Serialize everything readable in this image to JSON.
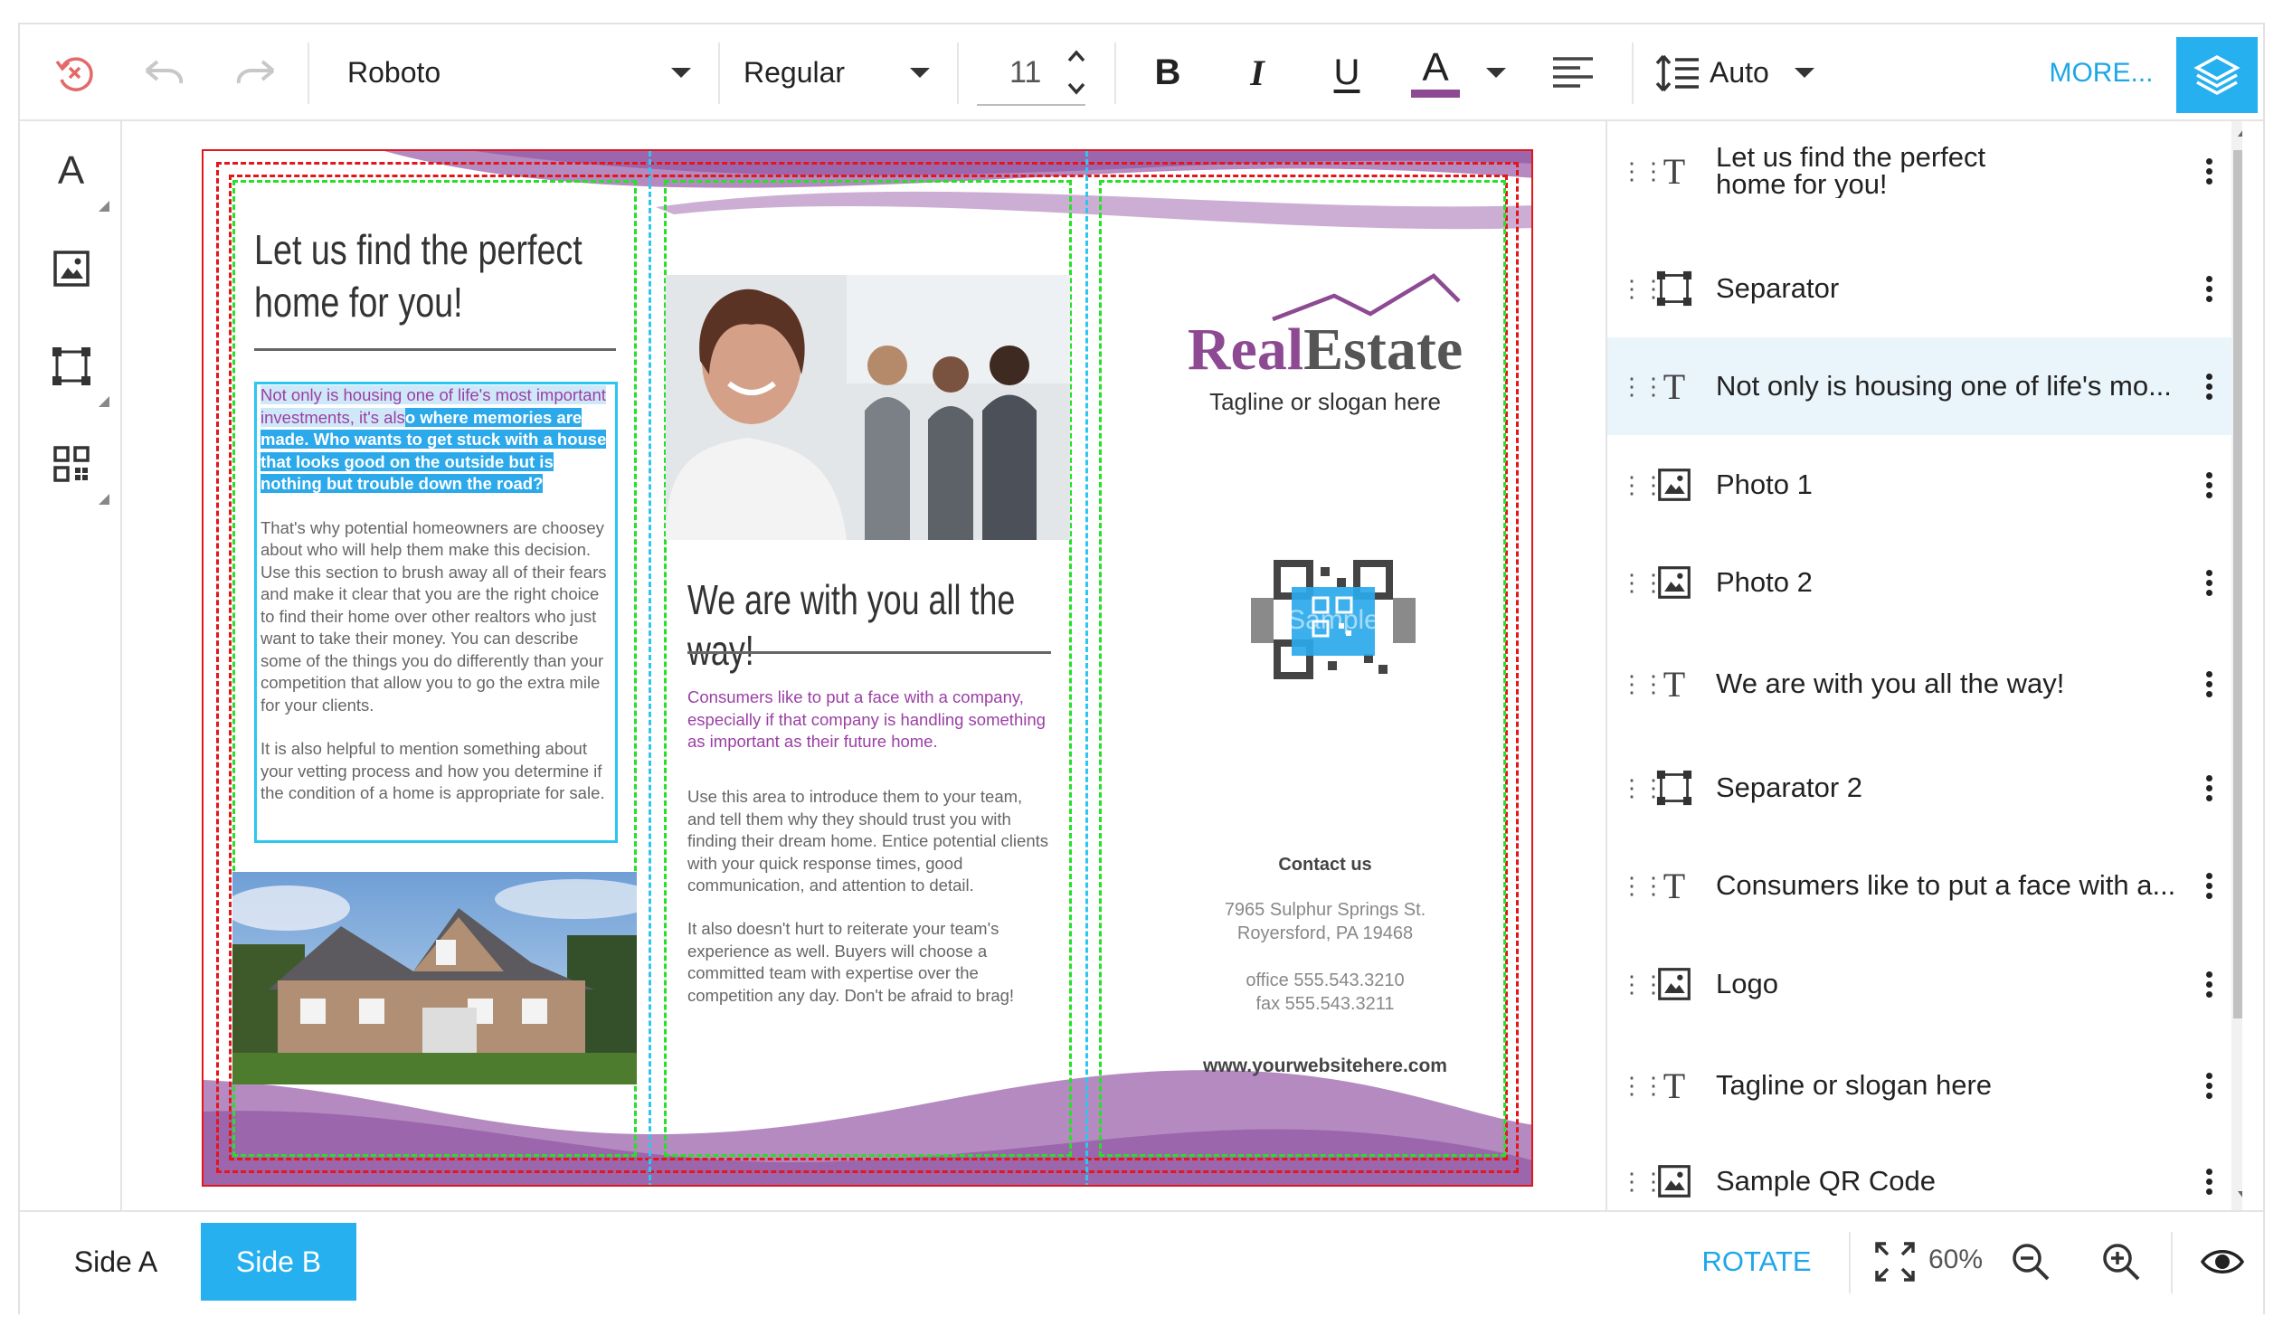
{
  "toolbar": {
    "font_family": "Roboto",
    "font_weight": "Regular",
    "font_size": "11",
    "line_height": "Auto",
    "more_label": "MORE...",
    "text_color": "#8d4a93",
    "accent": "#1ea7e8"
  },
  "doc": {
    "panel1": {
      "heading": "Let us find the perfect home for you!",
      "para_highlighted_a": "Not only is housing one of life's most important investments, it's als",
      "para_highlighted_b": "o where memories are made. Who wants to get stuck with a house that looks good on the outside but is nothing but trouble down the road?",
      "para2": "That's why potential homeowners are choosey about who will help them make this decision. Use this section to brush away all of their fears and make it clear that you are the right choice to find their home over other realtors who just want to take their money. You can describe some of the things you do differently than your competition that allow you to go the extra mile for your clients.",
      "para3": "It is also helpful to mention something about your vetting process and how you determine if the condition of a home is appropriate for sale."
    },
    "panel2": {
      "heading": "We are with you all the way!",
      "intro": "Consumers like to put a face with a company, especially if that company is handling something as important as their future home.",
      "para1": "Use this area to introduce them to your team, and tell them why they should trust you with finding their dream home. Entice potential clients with your quick response times, good communication, and attention to detail.",
      "para2": "It also doesn't hurt to reiterate your team's experience as well. Buyers will choose a committed team with expertise over the competition any day. Don't be afraid to brag!"
    },
    "panel3": {
      "logo_part1": "Real",
      "logo_part2": "Estate",
      "tagline": "Tagline or slogan here",
      "qr_watermark": "Sample",
      "contact_heading": "Contact us",
      "address1": "7965 Sulphur Springs St.",
      "address2": "Royersford, PA 19468",
      "office": "office 555.543.3210",
      "fax": "fax 555.543.3211",
      "website": "www.yourwebsitehere.com"
    }
  },
  "layers": [
    {
      "icon": "text",
      "label": "Let us find the perfect home for you!"
    },
    {
      "icon": "shape",
      "label": "Separator"
    },
    {
      "icon": "text",
      "label": "Not only is housing one of life's mo..."
    },
    {
      "icon": "image",
      "label": "Photo 1"
    },
    {
      "icon": "image",
      "label": "Photo 2"
    },
    {
      "icon": "text",
      "label": "We are with you all the way!"
    },
    {
      "icon": "shape",
      "label": "Separator 2"
    },
    {
      "icon": "text",
      "label": "Consumers like to put a face with a..."
    },
    {
      "icon": "image",
      "label": "Logo"
    },
    {
      "icon": "text",
      "label": "Tagline or slogan here"
    },
    {
      "icon": "image",
      "label": "Sample QR Code"
    }
  ],
  "bottom": {
    "side_a": "Side A",
    "side_b": "Side B",
    "rotate": "ROTATE",
    "zoom": "60%"
  }
}
